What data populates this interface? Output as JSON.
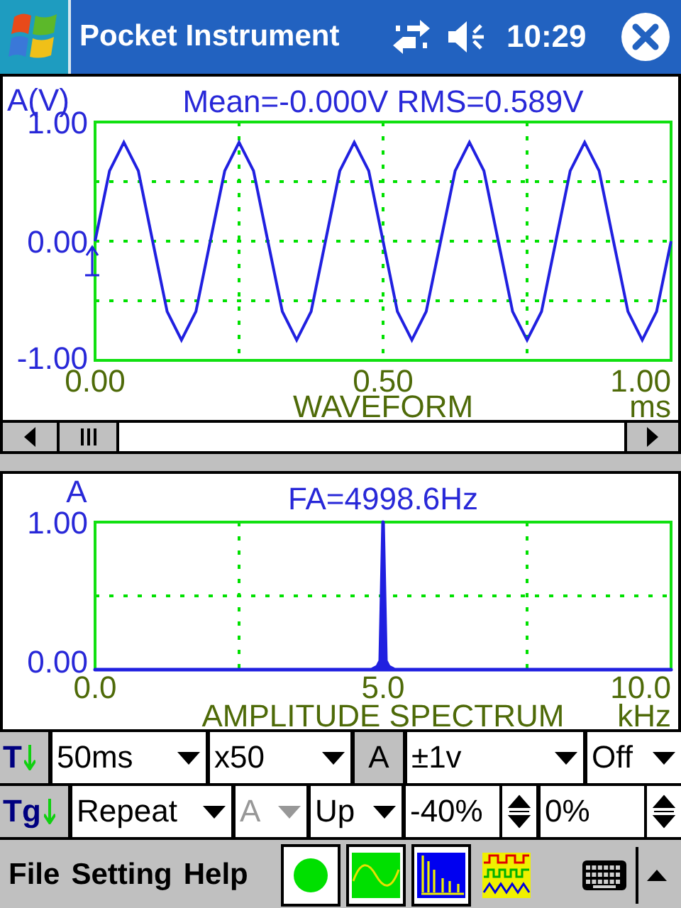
{
  "title_bar": {
    "title": "Pocket Instrument",
    "time": "10:29"
  },
  "waveform": {
    "measurement": "Mean=-0.000V RMS=0.589V",
    "chart_data": {
      "type": "line",
      "title": "WAVEFORM",
      "xlabel": "ms",
      "ylabel": "A(V)",
      "xlim": [
        0,
        1
      ],
      "ylim": [
        -1,
        1
      ],
      "xticks": [
        {
          "value": 0,
          "label": "0.00"
        },
        {
          "value": 0.5,
          "label": "0.50"
        },
        {
          "value": 1,
          "label": "1.00"
        }
      ],
      "yticks": [
        {
          "value": -1,
          "label": "-1.00"
        },
        {
          "value": 0,
          "label": "0.00"
        },
        {
          "value": 1,
          "label": "1.00"
        }
      ],
      "ref_lines": [
        {
          "axis": "x",
          "value": 0.25
        },
        {
          "axis": "x",
          "value": 0.5
        },
        {
          "axis": "x",
          "value": 0.75
        },
        {
          "axis": "y",
          "value": 0.5
        },
        {
          "axis": "y",
          "value": 0
        },
        {
          "axis": "y",
          "value": -0.5
        }
      ],
      "x": [
        0,
        0.025,
        0.05,
        0.075,
        0.1,
        0.125,
        0.15,
        0.175,
        0.2,
        0.225,
        0.25,
        0.275,
        0.3,
        0.325,
        0.35,
        0.375,
        0.4,
        0.425,
        0.45,
        0.475,
        0.5,
        0.525,
        0.55,
        0.575,
        0.6,
        0.625,
        0.65,
        0.675,
        0.7,
        0.725,
        0.75,
        0.775,
        0.8,
        0.825,
        0.85,
        0.875,
        0.9,
        0.925,
        0.95,
        0.975,
        1
      ],
      "series": [
        {
          "color": "#2020e0",
          "values": [
            0,
            0.59,
            0.83,
            0.59,
            0,
            -0.59,
            -0.83,
            -0.59,
            0,
            0.59,
            0.83,
            0.59,
            0,
            -0.59,
            -0.83,
            -0.59,
            0,
            0.59,
            0.83,
            0.59,
            0,
            -0.59,
            -0.83,
            -0.59,
            0,
            0.59,
            0.83,
            0.59,
            0,
            -0.59,
            -0.83,
            -0.59,
            0,
            0.59,
            0.83,
            0.59,
            0,
            -0.59,
            -0.83,
            -0.59,
            0
          ]
        }
      ]
    }
  },
  "spectrum": {
    "measurement": "FA=4998.6Hz",
    "chart_data": {
      "type": "area",
      "title": "AMPLITUDE SPECTRUM",
      "xlabel": "kHz",
      "ylabel": "A",
      "xlim": [
        0,
        10
      ],
      "ylim": [
        0,
        1
      ],
      "xticks": [
        {
          "value": 0,
          "label": "0.0"
        },
        {
          "value": 5,
          "label": "5.0"
        },
        {
          "value": 10,
          "label": "10.0"
        }
      ],
      "yticks": [
        {
          "value": 0,
          "label": "0.00"
        },
        {
          "value": 1,
          "label": "1.00"
        }
      ],
      "ref_lines": [
        {
          "axis": "x",
          "value": 2.5
        },
        {
          "axis": "x",
          "value": 7.5
        },
        {
          "axis": "y",
          "value": 0.5
        }
      ],
      "x": [
        0,
        4.8,
        4.9,
        4.95,
        5,
        5.05,
        5.1,
        5.2,
        10
      ],
      "series": [
        {
          "color": "#2020e0",
          "values": [
            0,
            0,
            0.02,
            0.06,
            1,
            0.06,
            0.02,
            0,
            0
          ]
        }
      ]
    }
  },
  "controls": [
    {
      "items": [
        {
          "kind": "label",
          "text": "T"
        },
        {
          "kind": "dropdown",
          "value": "50ms",
          "disabled": false
        },
        {
          "kind": "dropdown",
          "value": "x50",
          "disabled": false
        },
        {
          "kind": "button",
          "text": "A"
        },
        {
          "kind": "dropdown",
          "value": "±1v",
          "disabled": false
        },
        {
          "kind": "dropdown",
          "value": "Off",
          "disabled": false
        }
      ]
    },
    {
      "items": [
        {
          "kind": "label",
          "text": "Tg"
        },
        {
          "kind": "dropdown",
          "value": "Repeat",
          "disabled": false
        },
        {
          "kind": "dropdown",
          "value": "A",
          "disabled": true
        },
        {
          "kind": "dropdown",
          "value": "Up",
          "disabled": false
        },
        {
          "kind": "spinner",
          "value": "-40%"
        },
        {
          "kind": "spinner",
          "value": "0%"
        }
      ]
    }
  ],
  "menu": [
    {
      "label": "File"
    },
    {
      "label": "Setting"
    },
    {
      "label": "Help"
    }
  ],
  "toolbar": [
    {
      "kind": "dot"
    },
    {
      "kind": "sine"
    },
    {
      "kind": "bars"
    },
    {
      "kind": "waves"
    }
  ]
}
